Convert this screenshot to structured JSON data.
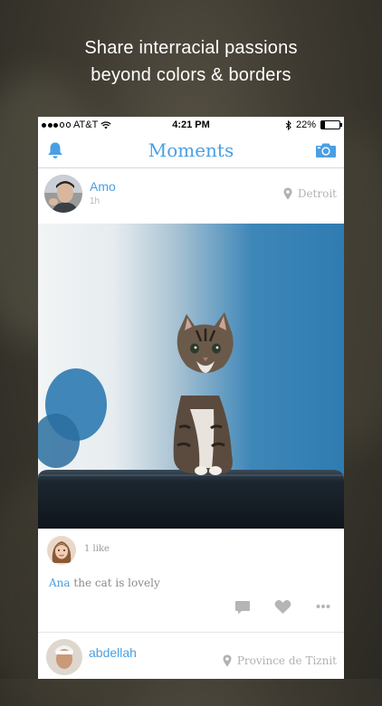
{
  "headline": {
    "line1": "Share interracial passions",
    "line2": "beyond colors & borders"
  },
  "status_bar": {
    "carrier": "AT&T",
    "time": "4:21 PM",
    "battery": "22%",
    "battery_level": 0.22
  },
  "nav": {
    "title": "Moments",
    "left_icon": "bell-icon",
    "right_icon": "camera-icon"
  },
  "post": {
    "user": "Amo",
    "time": "1h",
    "location": "Detroit",
    "likes": "1 like",
    "comment_user": "Ana",
    "comment_text": "the cat is lovely",
    "actions": [
      "comment-icon",
      "heart-icon",
      "more-icon"
    ]
  },
  "next_post": {
    "user": "abdellah",
    "location": "Province de Tiznit"
  },
  "colors": {
    "accent": "#4a9fe3",
    "muted": "#b2b2b2"
  }
}
